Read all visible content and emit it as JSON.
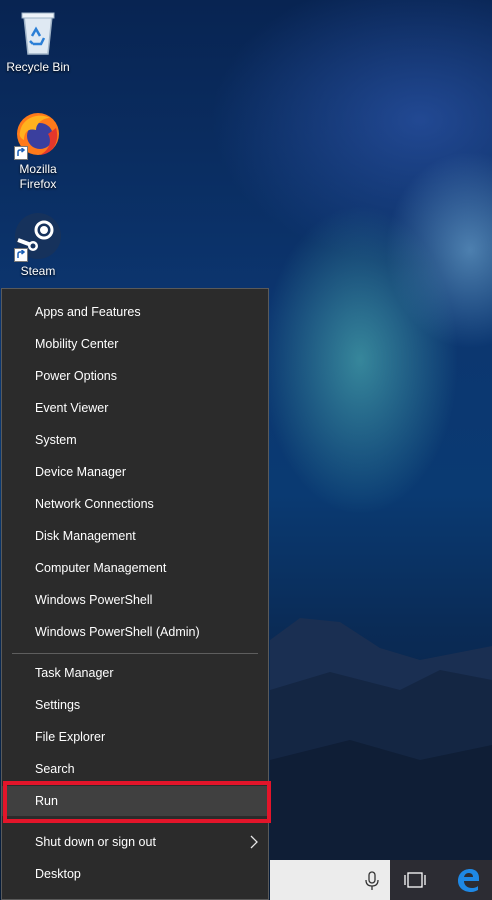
{
  "desktop": {
    "icons": [
      {
        "label": "Recycle Bin"
      },
      {
        "label": "Mozilla Firefox"
      },
      {
        "label": "Steam"
      }
    ]
  },
  "winx_menu": {
    "group1": [
      {
        "label": "Apps and Features"
      },
      {
        "label": "Mobility Center"
      },
      {
        "label": "Power Options"
      },
      {
        "label": "Event Viewer"
      },
      {
        "label": "System"
      },
      {
        "label": "Device Manager"
      },
      {
        "label": "Network Connections"
      },
      {
        "label": "Disk Management"
      },
      {
        "label": "Computer Management"
      },
      {
        "label": "Windows PowerShell"
      },
      {
        "label": "Windows PowerShell (Admin)"
      }
    ],
    "group2": [
      {
        "label": "Task Manager"
      },
      {
        "label": "Settings"
      },
      {
        "label": "File Explorer"
      },
      {
        "label": "Search"
      },
      {
        "label": "Run"
      }
    ],
    "group3": [
      {
        "label": "Shut down or sign out",
        "has_submenu": true
      },
      {
        "label": "Desktop"
      }
    ],
    "highlighted": "Run"
  },
  "taskbar": {
    "icons": [
      "microphone-icon",
      "task-view-icon",
      "edge-icon"
    ]
  },
  "colors": {
    "menu_bg": "#2b2b2b",
    "highlight": "#404040",
    "annotation_box": "#e3152a",
    "edge_blue": "#1e88e5"
  }
}
